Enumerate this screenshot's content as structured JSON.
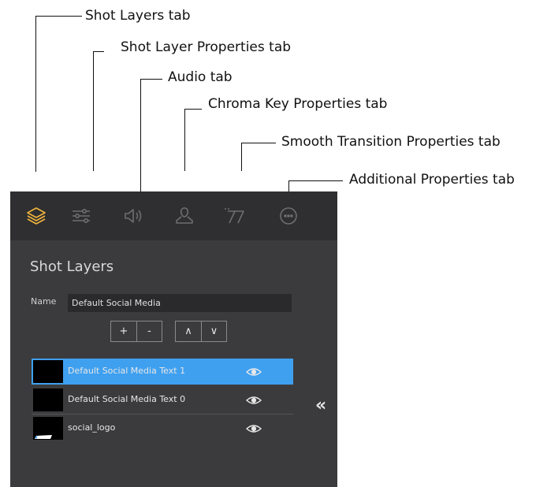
{
  "callouts": {
    "shot_layers_tab": "Shot Layers tab",
    "shot_layer_properties_tab": "Shot Layer Properties tab",
    "audio_tab": "Audio tab",
    "chroma_key_properties_tab": "Chroma Key Properties tab",
    "smooth_transition_properties_tab": "Smooth Transition Properties tab",
    "additional_properties_tab": "Additional Properties tab"
  },
  "panel": {
    "title": "Shot Layers",
    "name_label": "Name",
    "name_value": "Default Social Media",
    "buttons": {
      "add": "+",
      "remove": "-",
      "up": "∧",
      "down": "∨"
    },
    "collapse_label": "«",
    "tabs": [
      {
        "icon": "layers-icon",
        "active": true
      },
      {
        "icon": "sliders-icon",
        "active": false
      },
      {
        "icon": "speaker-icon",
        "active": false
      },
      {
        "icon": "person-icon",
        "active": false
      },
      {
        "icon": "transition-icon",
        "active": false
      },
      {
        "icon": "more-icon",
        "active": false
      }
    ],
    "layers": [
      {
        "name": "Default Social Media Text 1",
        "selected": true,
        "thumb": "black"
      },
      {
        "name": "Default Social Media Text 0",
        "selected": false,
        "thumb": "black"
      },
      {
        "name": "social_logo",
        "selected": false,
        "thumb": "logo"
      }
    ]
  },
  "colors": {
    "panel_bg": "#3b3b3d",
    "tabbar_bg": "#2f2f31",
    "active_tab": "#f0b43c",
    "inactive_tab": "#6e6e70",
    "selection": "#3fa0f0"
  }
}
